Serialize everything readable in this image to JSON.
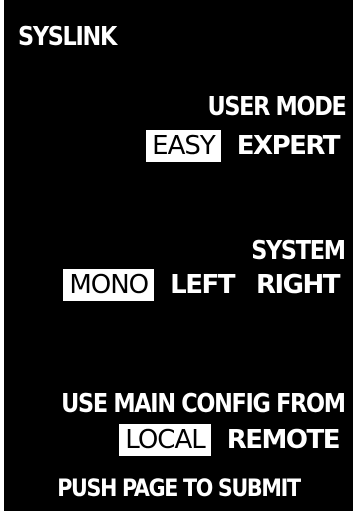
{
  "title": "SYSLINK",
  "user_mode": {
    "heading": "USER MODE",
    "options": [
      "EASY",
      "EXPERT"
    ],
    "selected": "EASY"
  },
  "system": {
    "heading": "SYSTEM",
    "options": [
      "MONO",
      "LEFT",
      "RIGHT"
    ],
    "selected": "MONO"
  },
  "config_source": {
    "heading": "USE MAIN CONFIG FROM",
    "options": [
      "LOCAL",
      "REMOTE"
    ],
    "selected": "LOCAL"
  },
  "footer": "PUSH PAGE TO SUBMIT",
  "colors": {
    "background": "#000000",
    "text": "#ffffff",
    "selected_background": "#ffffff",
    "selected_text": "#000000"
  }
}
